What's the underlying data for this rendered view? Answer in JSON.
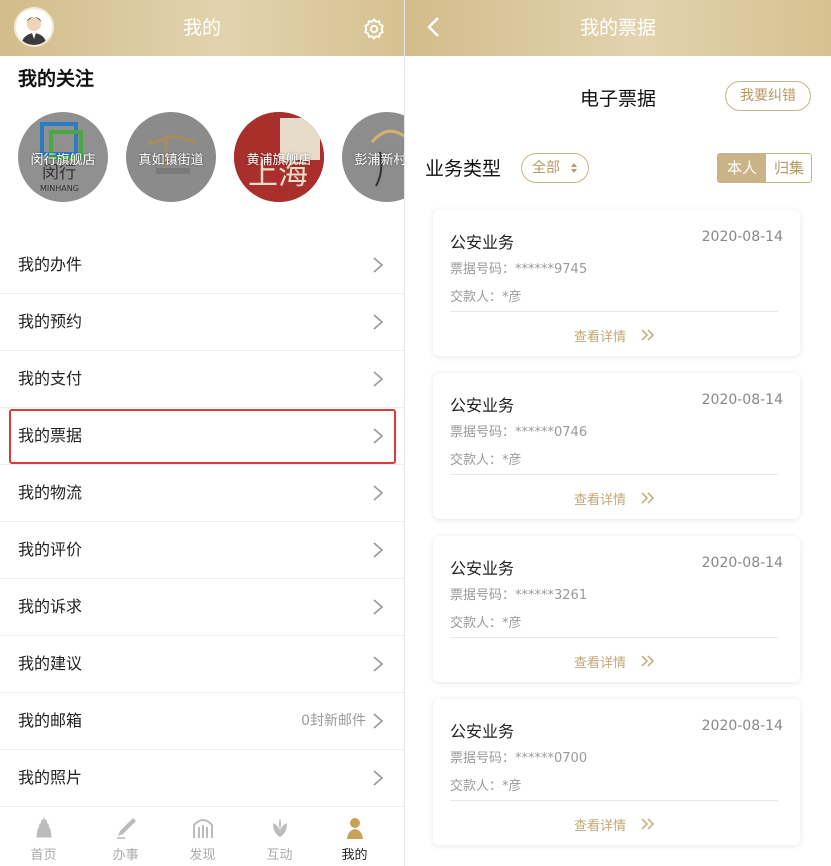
{
  "left": {
    "header": {
      "title": "我的"
    },
    "follow": {
      "title": "我的关注",
      "items": [
        {
          "label": "闵行旗舰店",
          "logo_text": "闵行",
          "logo_sub": "MINHANG",
          "bg": "#8f8f8f"
        },
        {
          "label": "真如镇街道",
          "bg": "#8a8a8a"
        },
        {
          "label": "黄浦旗舰店",
          "logo_text": "上海",
          "bg": "#b0322e"
        },
        {
          "label": "彭浦新村街",
          "bg": "#8d8d8d"
        }
      ]
    },
    "menu": [
      {
        "label": "我的办件"
      },
      {
        "label": "我的预约"
      },
      {
        "label": "我的支付"
      },
      {
        "label": "我的票据",
        "highlighted": true
      },
      {
        "label": "我的物流"
      },
      {
        "label": "我的评价"
      },
      {
        "label": "我的诉求"
      },
      {
        "label": "我的建议"
      },
      {
        "label": "我的邮箱",
        "extra": "0封新邮件"
      },
      {
        "label": "我的照片"
      }
    ],
    "tabbar": [
      {
        "label": "首页",
        "icon": "pagoda-icon"
      },
      {
        "label": "办事",
        "icon": "pen-icon"
      },
      {
        "label": "发现",
        "icon": "arch-icon"
      },
      {
        "label": "互动",
        "icon": "lotus-icon"
      },
      {
        "label": "我的",
        "icon": "person-icon",
        "active": true
      }
    ]
  },
  "right": {
    "header": {
      "title": "我的票据"
    },
    "doc_title": "电子票据",
    "correct_button": "我要纠错",
    "biz_type_label": "业务类型",
    "filter": "全部",
    "segments": [
      "本人",
      "归集"
    ],
    "cards": [
      {
        "title": "公安业务",
        "date": "2020-08-14",
        "number": "票据号码：******9745",
        "payer": "交款人：*彦",
        "detail": "查看详情"
      },
      {
        "title": "公安业务",
        "date": "2020-08-14",
        "number": "票据号码：******0746",
        "payer": "交款人：*彦",
        "detail": "查看详情"
      },
      {
        "title": "公安业务",
        "date": "2020-08-14",
        "number": "票据号码：******3261",
        "payer": "交款人：*彦",
        "detail": "查看详情"
      },
      {
        "title": "公安业务",
        "date": "2020-08-14",
        "number": "票据号码：******0700",
        "payer": "交款人：*彦",
        "detail": "查看详情"
      }
    ]
  },
  "colors": {
    "gold": "#c9b387",
    "gold_text": "#b49a63",
    "highlight_red": "#d93a3a"
  }
}
